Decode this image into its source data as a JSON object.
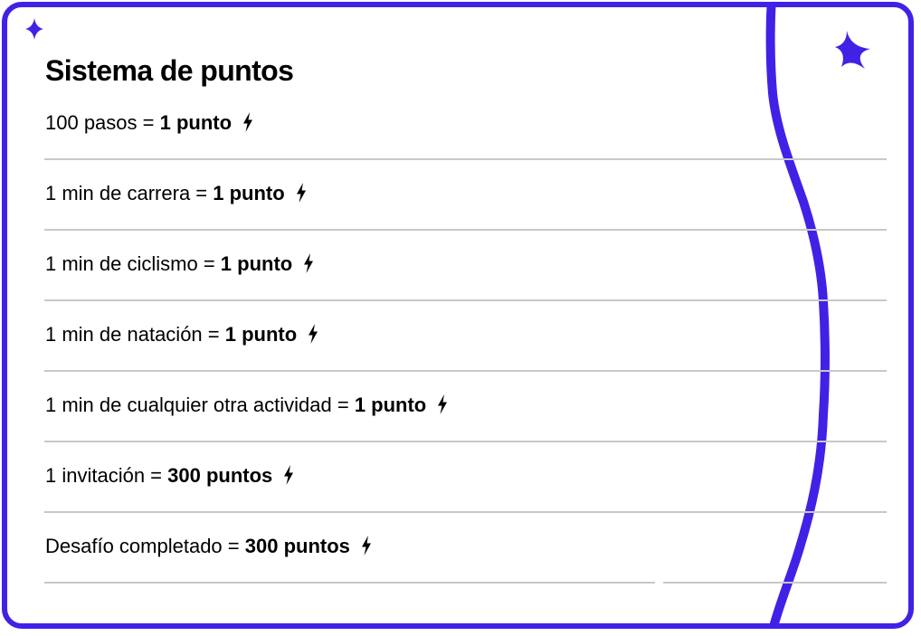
{
  "title": "Sistema de puntos",
  "accent_color": "#4221E6",
  "divider_color": "#c8c8c8",
  "rows": [
    {
      "text": "100 pasos = ",
      "value": "1 punto",
      "icon": "lightning-bolt-icon"
    },
    {
      "text": "1 min de carrera = ",
      "value": "1 punto",
      "icon": "lightning-bolt-icon"
    },
    {
      "text": "1 min de ciclismo = ",
      "value": "1 punto",
      "icon": "lightning-bolt-icon"
    },
    {
      "text": "1 min de natación = ",
      "value": "1 punto",
      "icon": "lightning-bolt-icon"
    },
    {
      "text": "1 min de cualquier otra actividad = ",
      "value": "1 punto",
      "icon": "lightning-bolt-icon"
    },
    {
      "text": "1 invitación = ",
      "value": "300 puntos",
      "icon": "lightning-bolt-icon"
    },
    {
      "text": "Desafío completado = ",
      "value": "300 puntos",
      "icon": "lightning-bolt-icon"
    }
  ]
}
